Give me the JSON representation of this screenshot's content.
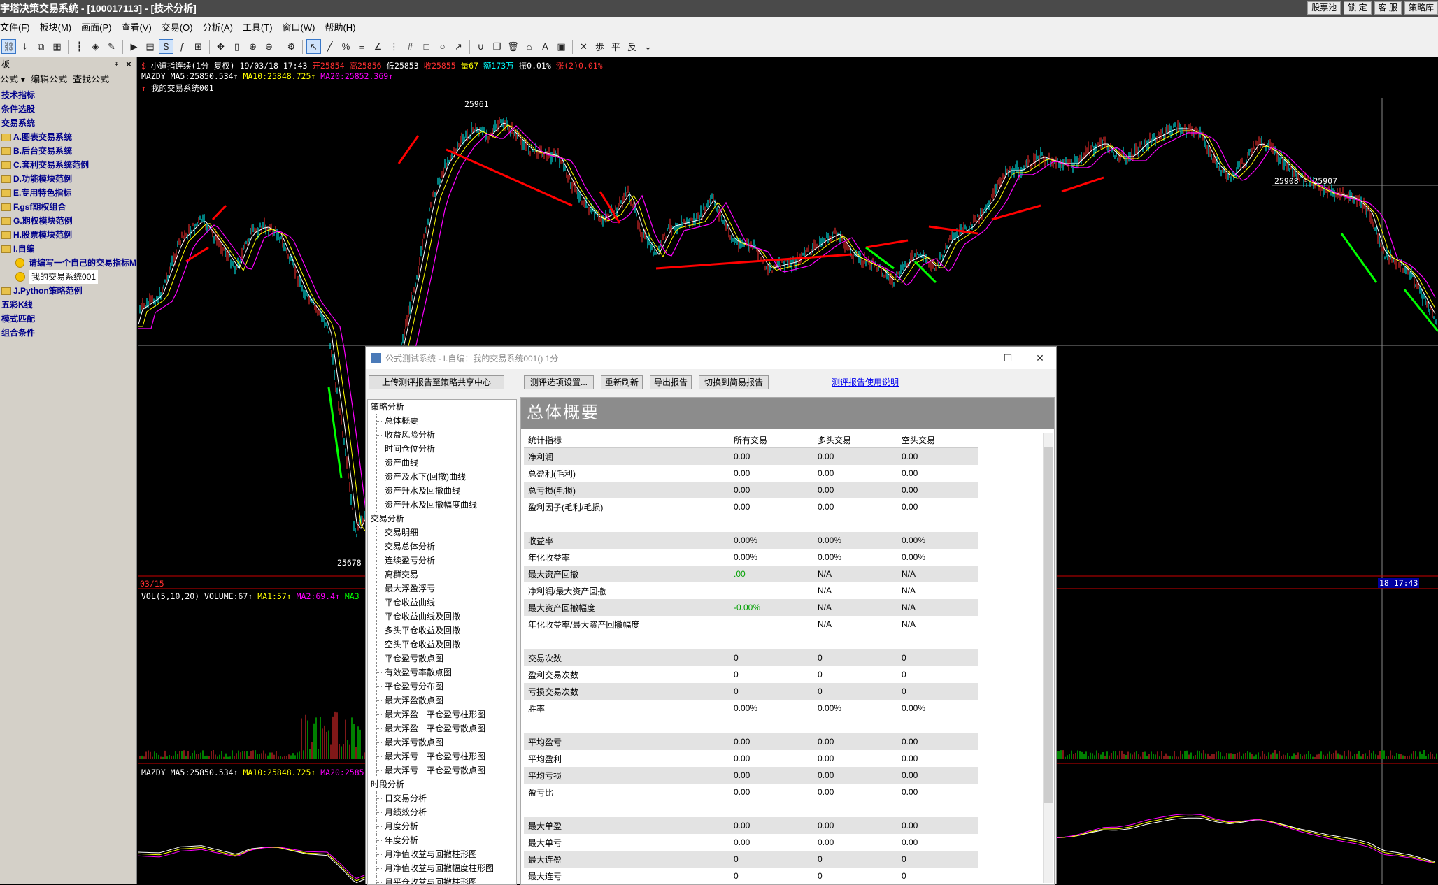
{
  "window": {
    "title": "宇塔决策交易系统 - [100017113] - [技术分析]",
    "right_buttons": [
      "股票池",
      "锁 定",
      "客 服",
      "策略库"
    ]
  },
  "menu": [
    "文件(F)",
    "板块(M)",
    "画面(P)",
    "查看(V)",
    "交易(O)",
    "分析(A)",
    "工具(T)",
    "窗口(W)",
    "帮助(H)"
  ],
  "sidebar": {
    "header": "板",
    "tools": [
      "公式 ▾",
      "编辑公式",
      "查找公式"
    ],
    "items": [
      {
        "label": "技术指标",
        "type": "root"
      },
      {
        "label": "条件选股",
        "type": "root"
      },
      {
        "label": "交易系统",
        "type": "root"
      },
      {
        "label": "A.图表交易系统",
        "type": "folder"
      },
      {
        "label": "B.后台交易系统",
        "type": "folder"
      },
      {
        "label": "C.套利交易系统范例",
        "type": "folder"
      },
      {
        "label": "D.功能模块范例",
        "type": "folder"
      },
      {
        "label": "E.专用特色指标",
        "type": "folder"
      },
      {
        "label": "F.gsf期权组合",
        "type": "folder"
      },
      {
        "label": "G.期权模块范例",
        "type": "folder"
      },
      {
        "label": "H.股票模块范例",
        "type": "folder"
      },
      {
        "label": "I.自编",
        "type": "folder"
      },
      {
        "label": "请编写一个自己的交易指标M",
        "type": "smile"
      },
      {
        "label": "我的交易系统001",
        "type": "smile-selected"
      },
      {
        "label": "J.Python策略范例",
        "type": "folder"
      },
      {
        "label": "五彩K线",
        "type": "root"
      },
      {
        "label": "模式匹配",
        "type": "root"
      },
      {
        "label": "组合条件",
        "type": "root"
      }
    ]
  },
  "chart": {
    "line1": {
      "symbol": "小道指连续(1分 复权)",
      "datetime": "19/03/18 17:43",
      "open": "开25854",
      "high": "高25856",
      "low": "低25853",
      "close": "收25855",
      "vol": "量67",
      "amount": "额173万",
      "amp": "振0.01%",
      "chg": "涨(2)0.01%"
    },
    "line2": {
      "name": "MAZDY",
      "ma5": "MA5:25850.534↑",
      "ma10": "MA10:25848.725↑",
      "ma20": "MA20:25852.369↑"
    },
    "line3": "我的交易系统001",
    "high_label": "25961",
    "low_label": "25678",
    "crosshair_label": "25908 - 25907",
    "date_left": "03/15",
    "time_right": "18 17:43",
    "vol_line": {
      "name": "VOL(5,10,20)",
      "volume": "VOLUME:67↑",
      "ma1": "MA1:57↑",
      "ma2": "MA2:69.4↑",
      "ma3": "MA3"
    },
    "lower_line": {
      "name": "MAZDY",
      "ma5": "MA5:25850.534↑",
      "ma10": "MA10:25848.725↑",
      "ma20": "MA20:2585"
    }
  },
  "dialog": {
    "title": "公式测试系统 - I.自编：我的交易系统001() 1分",
    "buttons": {
      "upload": "上传测评报告至策略共享中心",
      "settings": "测评选项设置...",
      "refresh": "重新刷新",
      "export": "导出报告",
      "switch": "切换到简易报告"
    },
    "help_link": "测评报告使用说明",
    "tree": [
      {
        "label": "策略分析",
        "lv": 1
      },
      {
        "label": "总体概要",
        "lv": 2
      },
      {
        "label": "收益风险分析",
        "lv": 2
      },
      {
        "label": "时间仓位分析",
        "lv": 2
      },
      {
        "label": "资产曲线",
        "lv": 2
      },
      {
        "label": "资产及水下(回撤)曲线",
        "lv": 2
      },
      {
        "label": "资产升水及回撤曲线",
        "lv": 2
      },
      {
        "label": "资产升水及回撤幅度曲线",
        "lv": 2
      },
      {
        "label": "交易分析",
        "lv": 1
      },
      {
        "label": "交易明细",
        "lv": 2
      },
      {
        "label": "交易总体分析",
        "lv": 2
      },
      {
        "label": "连续盈亏分析",
        "lv": 2
      },
      {
        "label": "离群交易",
        "lv": 2
      },
      {
        "label": "最大浮盈浮亏",
        "lv": 2
      },
      {
        "label": "平仓收益曲线",
        "lv": 2
      },
      {
        "label": "平仓收益曲线及回撤",
        "lv": 2
      },
      {
        "label": "多头平仓收益及回撤",
        "lv": 2
      },
      {
        "label": "空头平仓收益及回撤",
        "lv": 2
      },
      {
        "label": "平仓盈亏散点图",
        "lv": 2
      },
      {
        "label": "有效盈亏率散点图",
        "lv": 2
      },
      {
        "label": "平仓盈亏分布图",
        "lv": 2
      },
      {
        "label": "最大浮盈散点图",
        "lv": 2
      },
      {
        "label": "最大浮盈－平仓盈亏柱形图",
        "lv": 2
      },
      {
        "label": "最大浮盈－平仓盈亏散点图",
        "lv": 2
      },
      {
        "label": "最大浮亏散点图",
        "lv": 2
      },
      {
        "label": "最大浮亏－平仓盈亏柱形图",
        "lv": 2
      },
      {
        "label": "最大浮亏－平仓盈亏散点图",
        "lv": 2
      },
      {
        "label": "时段分析",
        "lv": 1
      },
      {
        "label": "日交易分析",
        "lv": 2
      },
      {
        "label": "月绩效分析",
        "lv": 2
      },
      {
        "label": "月度分析",
        "lv": 2
      },
      {
        "label": "年度分析",
        "lv": 2
      },
      {
        "label": "月净值收益与回撤柱形图",
        "lv": 2
      },
      {
        "label": "月净值收益与回撤幅度柱形图",
        "lv": 2
      },
      {
        "label": "月平仓收益与回撤柱形图",
        "lv": 2
      }
    ],
    "report_title": "总体概要",
    "columns": [
      "统计指标",
      "所有交易",
      "多头交易",
      "空头交易"
    ],
    "rows": [
      {
        "k": "净利润",
        "a": "0.00",
        "b": "0.00",
        "c": "0.00",
        "bg": "g"
      },
      {
        "k": "总盈利(毛利)",
        "a": "0.00",
        "b": "0.00",
        "c": "0.00",
        "bg": "w"
      },
      {
        "k": "总亏损(毛损)",
        "a": "0.00",
        "b": "0.00",
        "c": "0.00",
        "bg": "g"
      },
      {
        "k": "盈利因子(毛利/毛损)",
        "a": "0.00",
        "b": "0.00",
        "c": "0.00",
        "bg": "w"
      },
      {
        "k": "",
        "a": "",
        "b": "",
        "c": "",
        "bg": "w"
      },
      {
        "k": "收益率",
        "a": "0.00%",
        "b": "0.00%",
        "c": "0.00%",
        "bg": "g"
      },
      {
        "k": "年化收益率",
        "a": "0.00%",
        "b": "0.00%",
        "c": "0.00%",
        "bg": "w"
      },
      {
        "k": "最大资产回撤",
        "a": ".00",
        "b": "N/A",
        "c": "N/A",
        "bg": "g",
        "green": true
      },
      {
        "k": "净利润/最大资产回撤",
        "a": "",
        "b": "N/A",
        "c": "N/A",
        "bg": "w"
      },
      {
        "k": "最大资产回撤幅度",
        "a": "-0.00%",
        "b": "N/A",
        "c": "N/A",
        "bg": "g",
        "green": true
      },
      {
        "k": "年化收益率/最大资产回撤幅度",
        "a": "",
        "b": "N/A",
        "c": "N/A",
        "bg": "w"
      },
      {
        "k": "",
        "a": "",
        "b": "",
        "c": "",
        "bg": "w"
      },
      {
        "k": "交易次数",
        "a": "0",
        "b": "0",
        "c": "0",
        "bg": "g"
      },
      {
        "k": "盈利交易次数",
        "a": "0",
        "b": "0",
        "c": "0",
        "bg": "w"
      },
      {
        "k": "亏损交易次数",
        "a": "0",
        "b": "0",
        "c": "0",
        "bg": "g"
      },
      {
        "k": "胜率",
        "a": "0.00%",
        "b": "0.00%",
        "c": "0.00%",
        "bg": "w"
      },
      {
        "k": "",
        "a": "",
        "b": "",
        "c": "",
        "bg": "w"
      },
      {
        "k": "平均盈亏",
        "a": "0.00",
        "b": "0.00",
        "c": "0.00",
        "bg": "g"
      },
      {
        "k": "平均盈利",
        "a": "0.00",
        "b": "0.00",
        "c": "0.00",
        "bg": "w"
      },
      {
        "k": "平均亏损",
        "a": "0.00",
        "b": "0.00",
        "c": "0.00",
        "bg": "g"
      },
      {
        "k": "盈亏比",
        "a": "0.00",
        "b": "0.00",
        "c": "0.00",
        "bg": "w"
      },
      {
        "k": "",
        "a": "",
        "b": "",
        "c": "",
        "bg": "w"
      },
      {
        "k": "最大单盈",
        "a": "0.00",
        "b": "0.00",
        "c": "0.00",
        "bg": "g"
      },
      {
        "k": "最大单亏",
        "a": "0.00",
        "b": "0.00",
        "c": "0.00",
        "bg": "w"
      },
      {
        "k": "最大连盈",
        "a": "0",
        "b": "0",
        "c": "0",
        "bg": "g"
      },
      {
        "k": "最大连亏",
        "a": "0",
        "b": "0",
        "c": "0",
        "bg": "w"
      }
    ]
  },
  "colors": {
    "up": "#ff3030",
    "down": "#00ffff",
    "ma5": "#ffffff",
    "ma10": "#ffff00",
    "ma20": "#ff00ff",
    "signal_up": "#00ff00",
    "signal_line": "#ff0000"
  }
}
